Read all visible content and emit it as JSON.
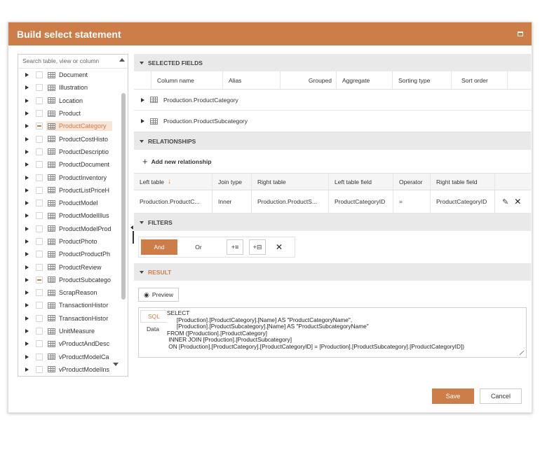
{
  "dialog": {
    "title": "Build select statement",
    "maximize_icon": "maximize-icon"
  },
  "tree": {
    "search_placeholder": "Search table, view or column",
    "items": [
      {
        "label": "Document",
        "state": "unchecked"
      },
      {
        "label": "Illustration",
        "state": "unchecked"
      },
      {
        "label": "Location",
        "state": "unchecked"
      },
      {
        "label": "Product",
        "state": "unchecked"
      },
      {
        "label": "ProductCategory",
        "state": "indeterminate",
        "selected": true
      },
      {
        "label": "ProductCostHisto",
        "state": "unchecked"
      },
      {
        "label": "ProductDescriptio",
        "state": "unchecked"
      },
      {
        "label": "ProductDocument",
        "state": "unchecked"
      },
      {
        "label": "ProductInventory",
        "state": "unchecked"
      },
      {
        "label": "ProductListPriceH",
        "state": "unchecked"
      },
      {
        "label": "ProductModel",
        "state": "unchecked"
      },
      {
        "label": "ProductModelIllus",
        "state": "unchecked"
      },
      {
        "label": "ProductModelProd",
        "state": "unchecked"
      },
      {
        "label": "ProductPhoto",
        "state": "unchecked"
      },
      {
        "label": "ProductProductPh",
        "state": "unchecked"
      },
      {
        "label": "ProductReview",
        "state": "unchecked"
      },
      {
        "label": "ProductSubcatego",
        "state": "indeterminate"
      },
      {
        "label": "ScrapReason",
        "state": "unchecked"
      },
      {
        "label": "TransactionHistor",
        "state": "unchecked"
      },
      {
        "label": "TransactionHistor",
        "state": "unchecked"
      },
      {
        "label": "UnitMeasure",
        "state": "unchecked"
      },
      {
        "label": "vProductAndDesc",
        "state": "unchecked"
      },
      {
        "label": "vProductModelCa",
        "state": "unchecked"
      },
      {
        "label": "vProductModelIns",
        "state": "unchecked"
      }
    ]
  },
  "selected_fields": {
    "header": "SELECTED FIELDS",
    "columns": [
      "Column name",
      "Alias",
      "Grouped",
      "Aggregate",
      "Sorting type",
      "Sort order"
    ],
    "groups": [
      "Production.ProductCategory",
      "Production.ProductSubcategory"
    ]
  },
  "relationships": {
    "header": "RELATIONSHIPS",
    "add_label": "Add new relationship",
    "columns": [
      "Left table",
      "Join type",
      "Right table",
      "Left table field",
      "Operator",
      "Right table field"
    ],
    "rows": [
      [
        "Production.ProductC...",
        "Inner",
        "Production.ProductS...",
        "ProductCategoryID",
        "=",
        "ProductCategoryID"
      ]
    ]
  },
  "filters": {
    "header": "FILTERS",
    "and_label": "And",
    "or_label": "Or"
  },
  "result": {
    "header": "RESULT",
    "preview_label": "Preview",
    "tabs": [
      "SQL",
      "Data"
    ],
    "sql": "SELECT\n      [Production].[ProductCategory].[Name] AS \"ProductCategoryName\",\n      [Production].[ProductSubcategory].[Name] AS \"ProductSubcategoryName\"\nFROM ([Production].[ProductCategory]\n INNER JOIN [Production].[ProductSubcategory]\n ON [Production].[ProductCategory].[ProductCategoryID] = [Production].[ProductSubcategory].[ProductCategoryID])"
  },
  "footer": {
    "save_label": "Save",
    "cancel_label": "Cancel"
  },
  "colors": {
    "accent": "#cd7d48",
    "section_bg": "#e9e9e9"
  }
}
